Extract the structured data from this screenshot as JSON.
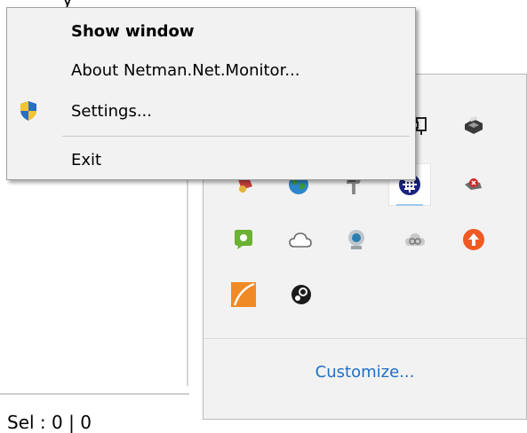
{
  "background": {
    "top_text": "y",
    "status_text": "Sel : 0 | 0"
  },
  "context_menu": {
    "items": [
      {
        "label": "Show window",
        "bold": true
      },
      {
        "label": "About Netman.Net.Monitor..."
      },
      {
        "label": "Settings...",
        "icon": "shield-icon"
      },
      {
        "label": "Exit"
      }
    ]
  },
  "tray_flyout": {
    "customize_label": "Customize...",
    "icons": [
      "network-icon",
      "printer-icon",
      "media-icon",
      "globe-icon",
      "usb-drive-icon",
      "net-monitor-icon",
      "no-network-icon",
      "messenger-icon",
      "cloud-icon",
      "webcam-icon",
      "creative-cloud-icon",
      "update-arrow-icon",
      "app-orange-icon",
      "steam-icon"
    ]
  },
  "colors": {
    "link": "#1f6fc5",
    "menu_bg": "#f2f2f2",
    "tray_bg": "#f2f2f2"
  }
}
